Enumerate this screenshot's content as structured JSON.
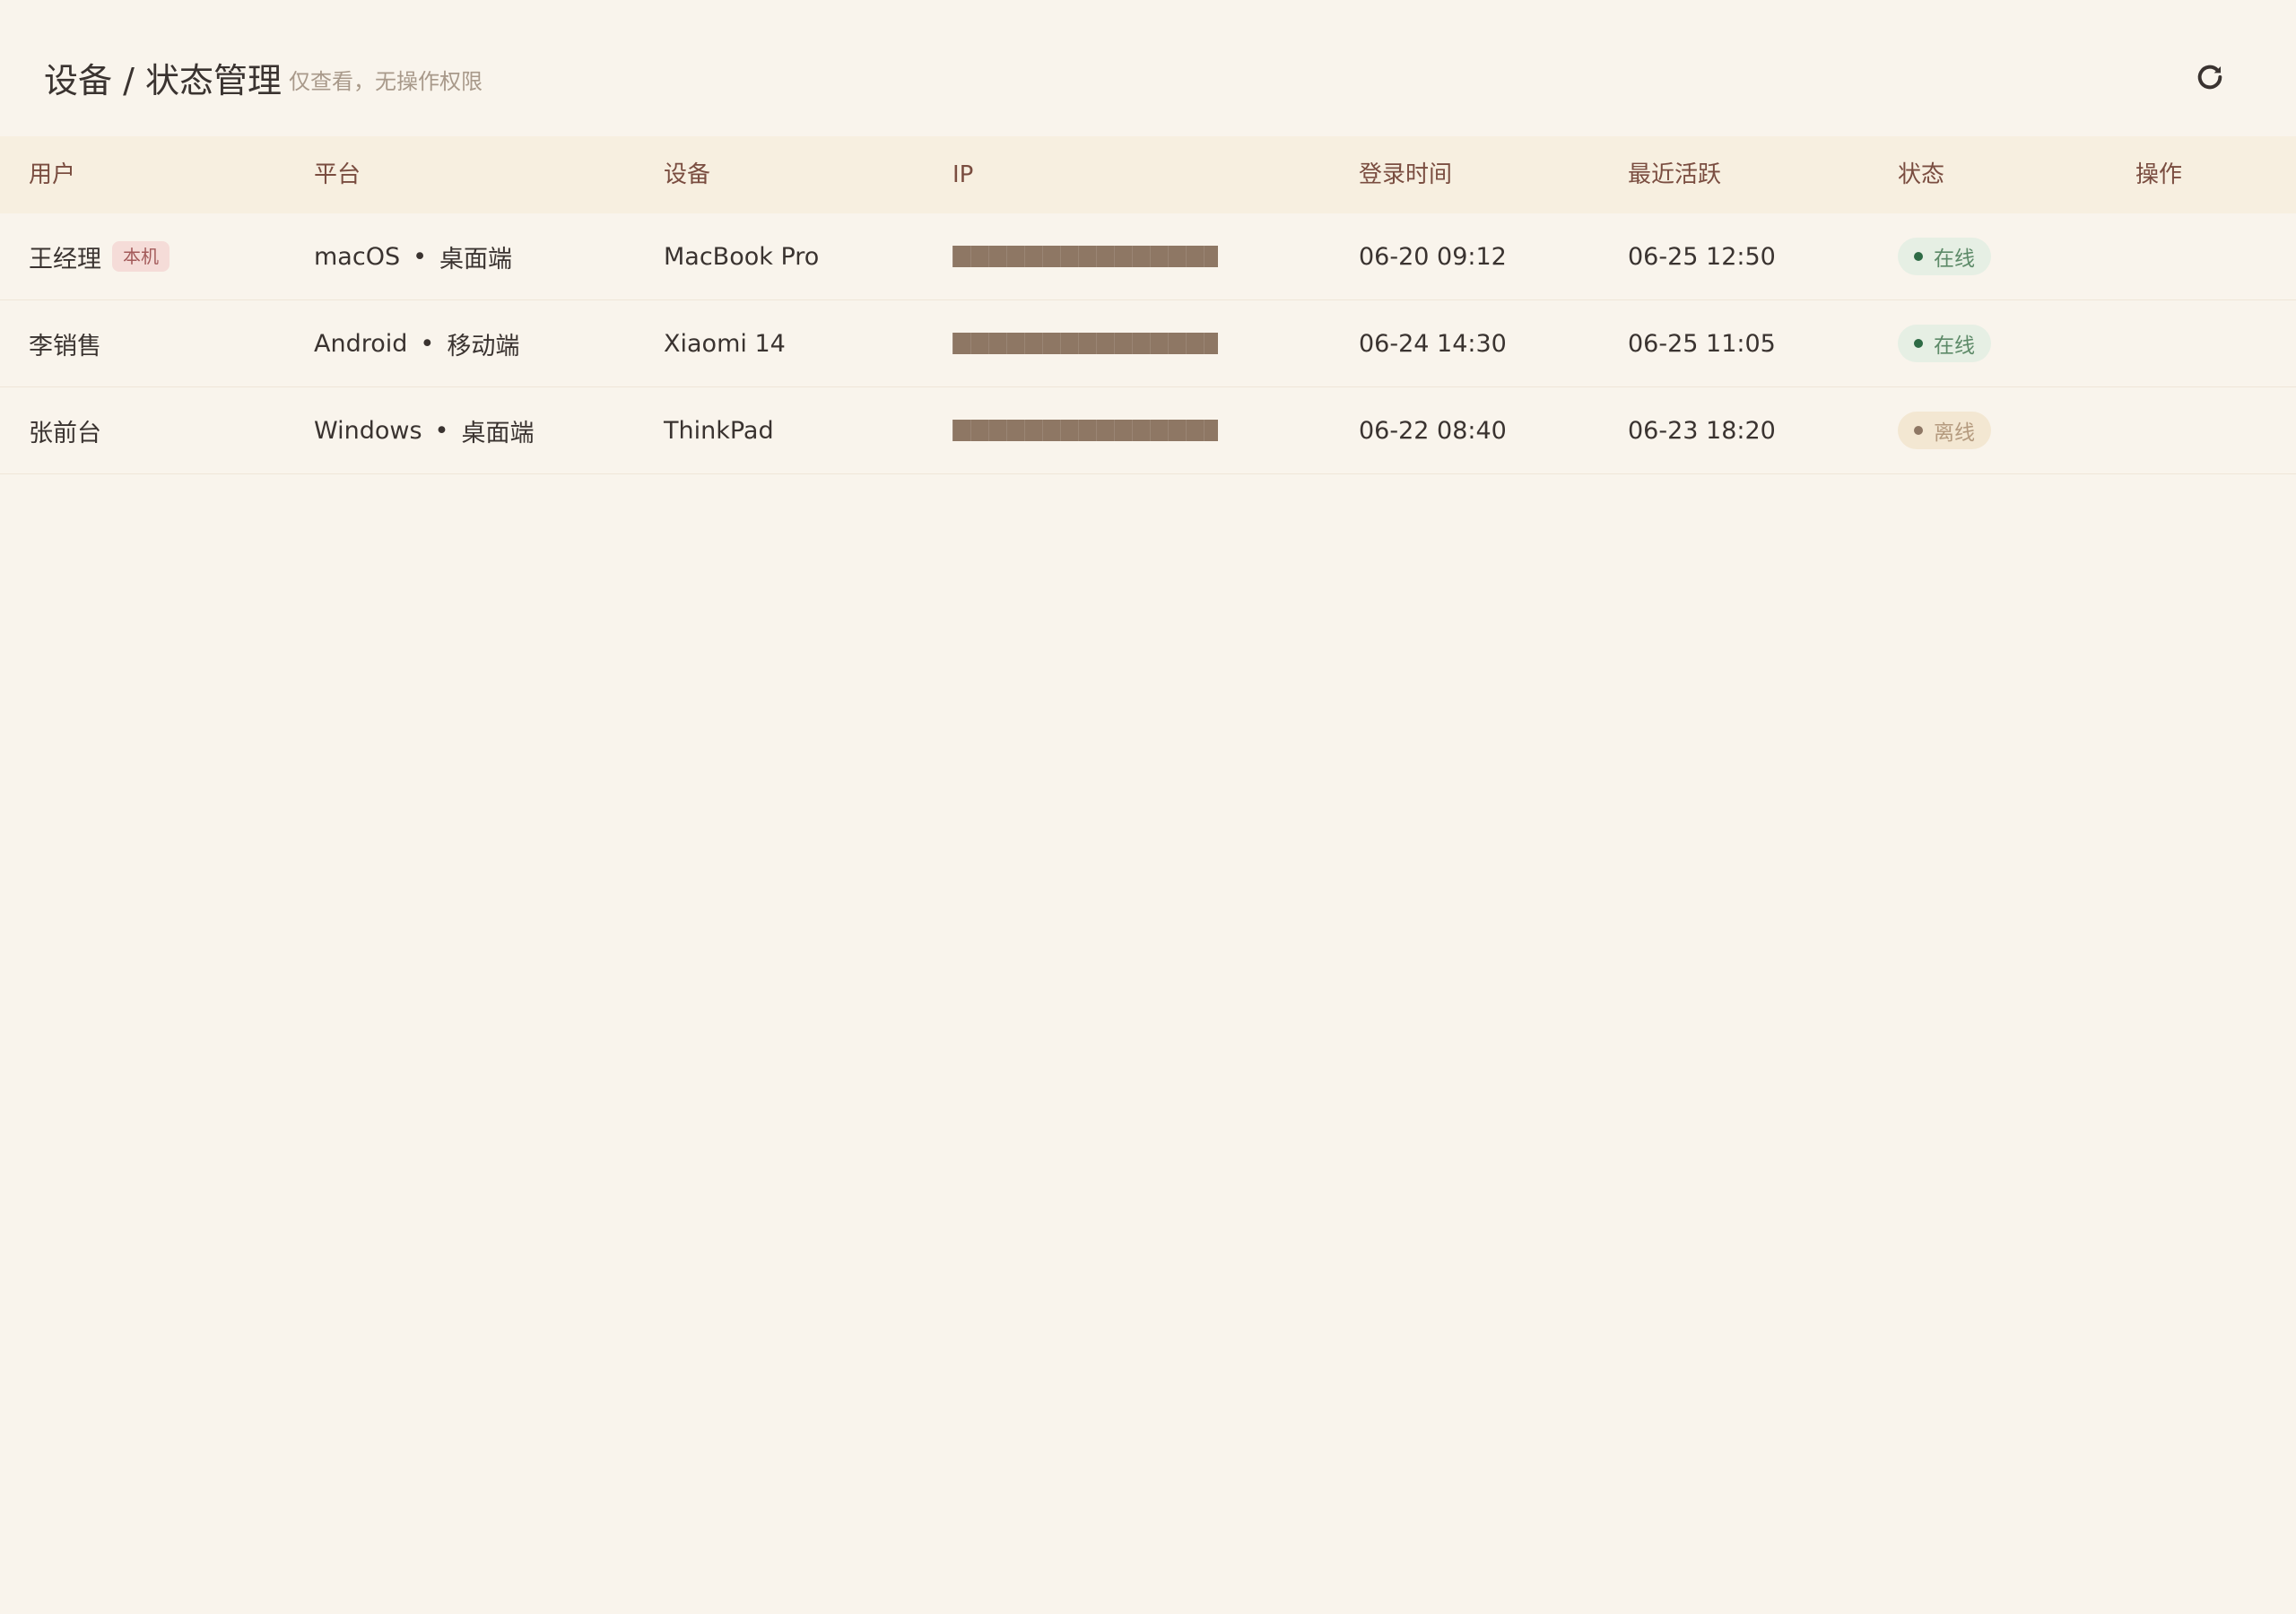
{
  "header": {
    "title": "设备 / 状态管理",
    "subtitle": "仅查看，无操作权限",
    "refresh_icon": "refresh-icon"
  },
  "table": {
    "columns": [
      "用户",
      "平台",
      "设备",
      "IP",
      "登录时间",
      "最近活跃",
      "状态",
      "操作"
    ],
    "rows": [
      {
        "user": "王经理",
        "badge": "本机",
        "os": "macOS",
        "client": "桌面端",
        "device": "MacBook Pro",
        "ip": "████████████████",
        "login": "06-20 09:12",
        "active": "06-25 12:50",
        "status": "在线",
        "status_type": "online"
      },
      {
        "user": "李销售",
        "badge": "",
        "os": "Android",
        "client": "移动端",
        "device": "Xiaomi 14",
        "ip": "████████████████",
        "login": "06-24 14:30",
        "active": "06-25 11:05",
        "status": "在线",
        "status_type": "online"
      },
      {
        "user": "张前台",
        "badge": "",
        "os": "Windows",
        "client": "桌面端",
        "device": "ThinkPad",
        "ip": "████████████████",
        "login": "06-22 08:40",
        "active": "06-23 18:20",
        "status": "离线",
        "status_type": "offline"
      }
    ]
  },
  "colors": {
    "background": "#f9f4ec",
    "header_row": "#f7efe0",
    "header_text": "#7a4d40",
    "online_dot": "#2e6b45",
    "offline_dot": "#8e7764",
    "ip_mask": "#8e7764"
  }
}
